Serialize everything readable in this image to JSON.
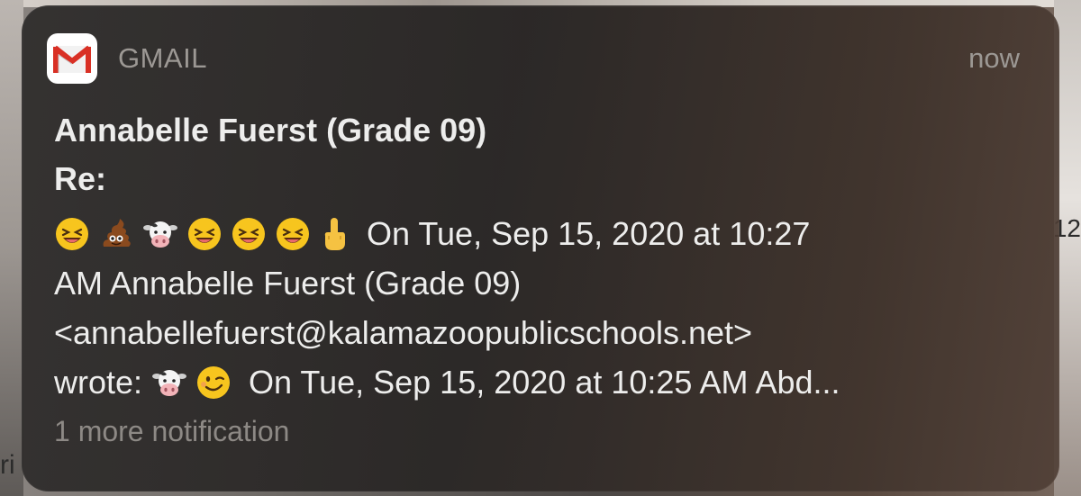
{
  "notification": {
    "app_name": "GMAIL",
    "time": "now",
    "sender": "Annabelle Fuerst (Grade 09)",
    "subject": "Re:",
    "body_line1_text": "On Tue, Sep 15, 2020 at 10:27",
    "body_line2": "AM Annabelle Fuerst (Grade 09)",
    "body_line3": "<annabellefuerst@kalamazoopublicschools.net>",
    "body_line4_prefix": "wrote:",
    "body_line4_suffix": "On Tue, Sep 15, 2020 at 10:25 AM Abd...",
    "more_notifications": "1 more notification",
    "line1_emojis": [
      "laughing-face",
      "pile-of-poo",
      "cow-face",
      "laughing-face",
      "laughing-face",
      "laughing-face",
      "middle-finger"
    ],
    "line4_emojis": [
      "cow-face",
      "winking-face"
    ]
  },
  "background": {
    "left_edge_glyph": "ri",
    "right_edge_glyph": "12"
  },
  "colors": {
    "card_background": "#2e2c2b",
    "primary_text": "#ededec",
    "secondary_text": "#9c9894",
    "gmail_red": "#d93025"
  }
}
